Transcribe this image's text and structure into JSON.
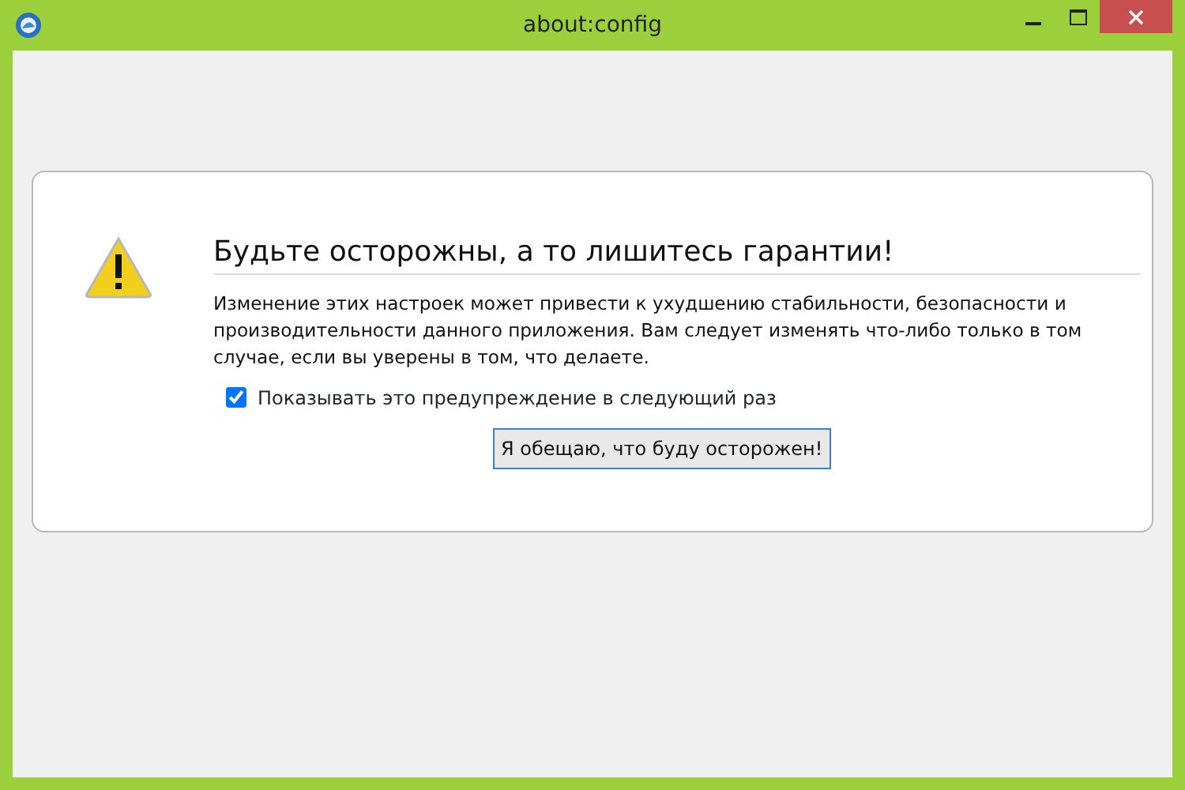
{
  "window": {
    "title": "about:config"
  },
  "warning": {
    "heading": "Будьте осторожны, а то лишитесь гарантии!",
    "message": "Изменение этих настроек может привести к ухудшению стабильности, безопасности и производительности данного приложения. Вам следует изменять что-либо только в том случае, если вы уверены в том, что делаете.",
    "checkbox": {
      "label": "Показывать это предупреждение в следующий раз",
      "checked": true
    },
    "button": "Я обещаю, что буду осторожен!"
  }
}
